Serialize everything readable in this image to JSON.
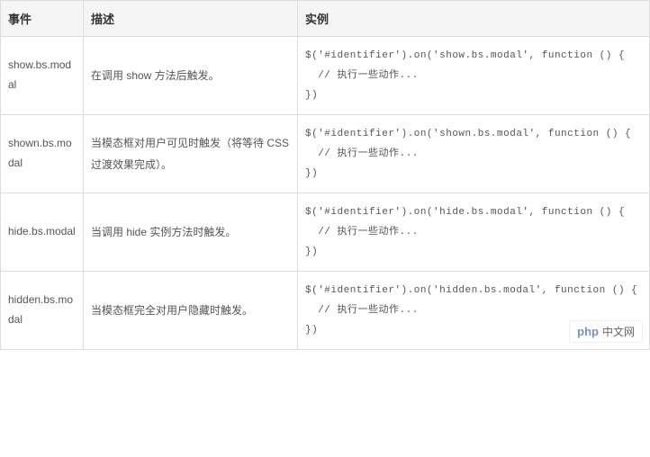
{
  "table": {
    "headers": [
      "事件",
      "描述",
      "实例"
    ],
    "rows": [
      {
        "event": "show.bs.modal",
        "description": "在调用 show 方法后触发。",
        "code": "$('#identifier').on('show.bs.modal', function () {\n  // 执行一些动作...\n})"
      },
      {
        "event": "shown.bs.modal",
        "description": "当模态框对用户可见时触发（将等待 CSS 过渡效果完成）。",
        "code": "$('#identifier').on('shown.bs.modal', function () {\n  // 执行一些动作...\n})"
      },
      {
        "event": "hide.bs.modal",
        "description": "当调用 hide 实例方法时触发。",
        "code": "$('#identifier').on('hide.bs.modal', function () {\n  // 执行一些动作...\n})"
      },
      {
        "event": "hidden.bs.modal",
        "description": "当模态框完全对用户隐藏时触发。",
        "code": "$('#identifier').on('hidden.bs.modal', function () {\n  // 执行一些动作...\n})"
      }
    ]
  },
  "watermark": {
    "logo": "php",
    "text": "中文网"
  }
}
